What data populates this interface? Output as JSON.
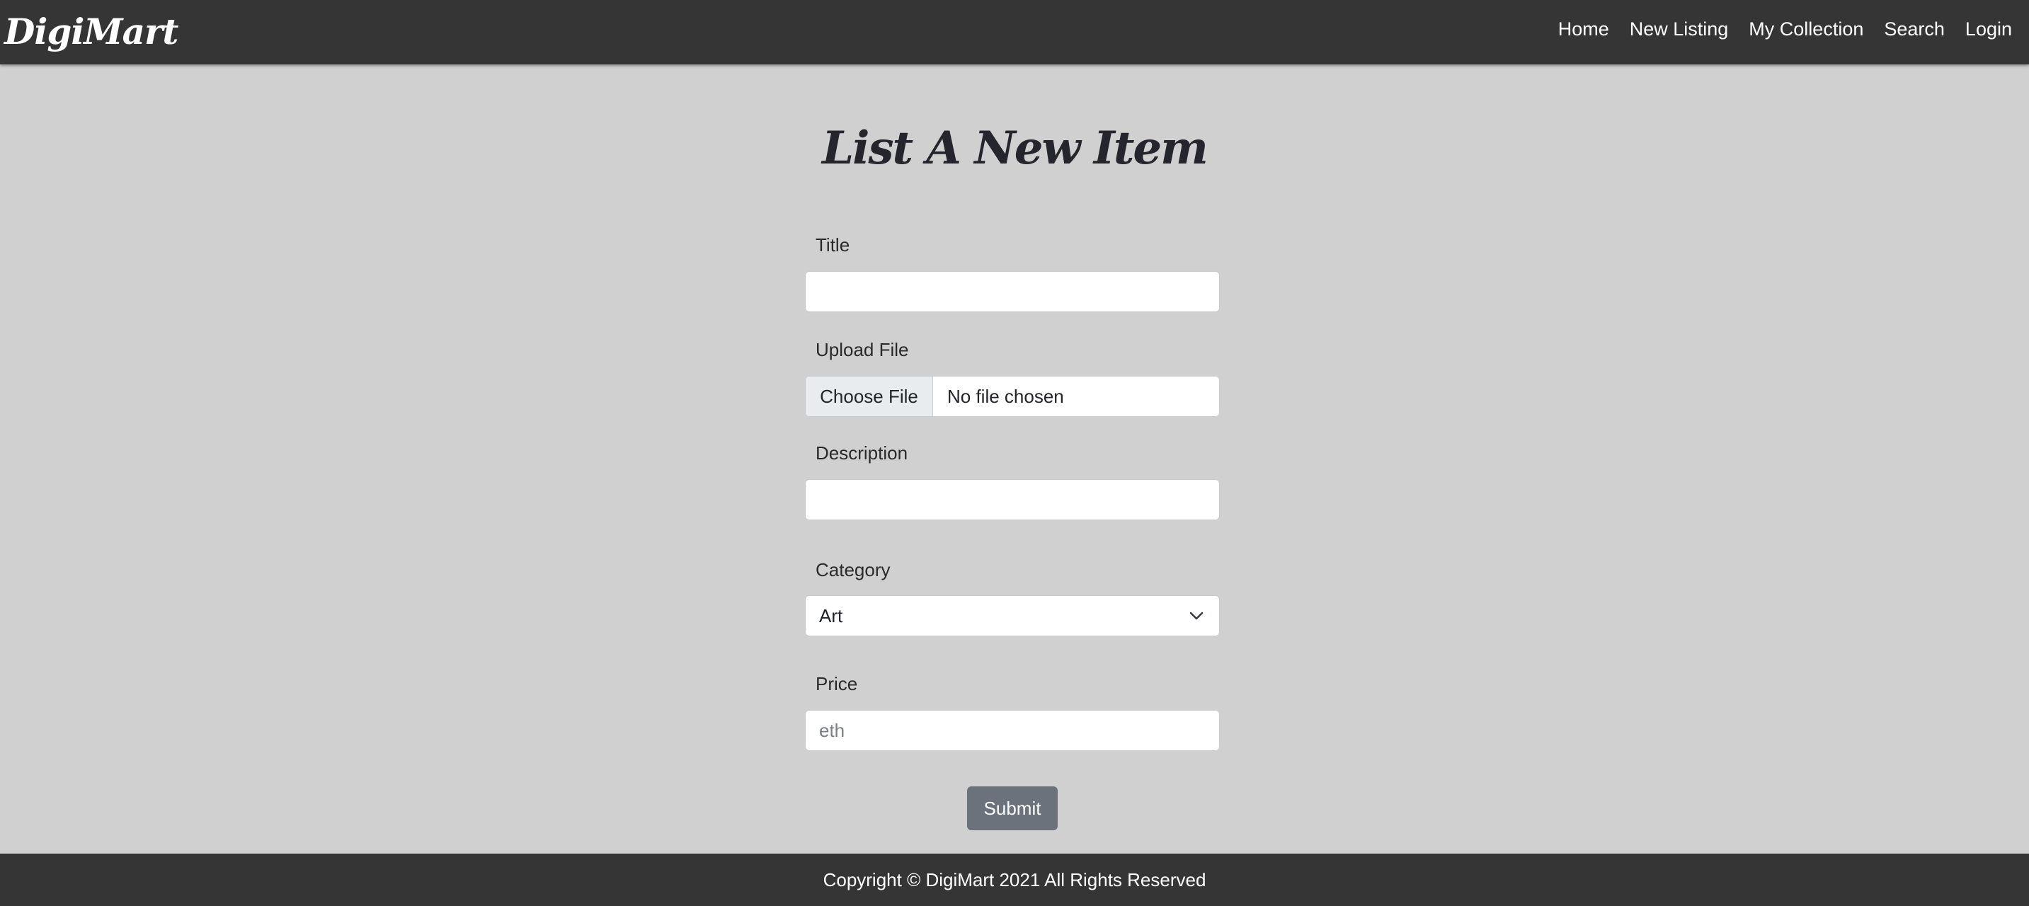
{
  "nav": {
    "brand": "DigiMart",
    "links": [
      "Home",
      "New Listing",
      "My Collection",
      "Search",
      "Login"
    ]
  },
  "page": {
    "title": "List A New Item"
  },
  "form": {
    "title_label": "Title",
    "title_value": "",
    "upload_label": "Upload File",
    "upload_button": "Choose File",
    "upload_status": "No file chosen",
    "description_label": "Description",
    "description_value": "",
    "category_label": "Category",
    "category_value": "Art",
    "price_label": "Price",
    "price_placeholder": "eth",
    "submit_label": "Submit"
  },
  "footer": {
    "text": "Copyright © DigiMart 2021 All Rights Reserved"
  },
  "icons": {
    "category_dropdown": "chevron-down-icon"
  },
  "colors": {
    "navbar": "#353535",
    "page_background": "#d0d0d0",
    "submit_button": "#6c727b"
  }
}
